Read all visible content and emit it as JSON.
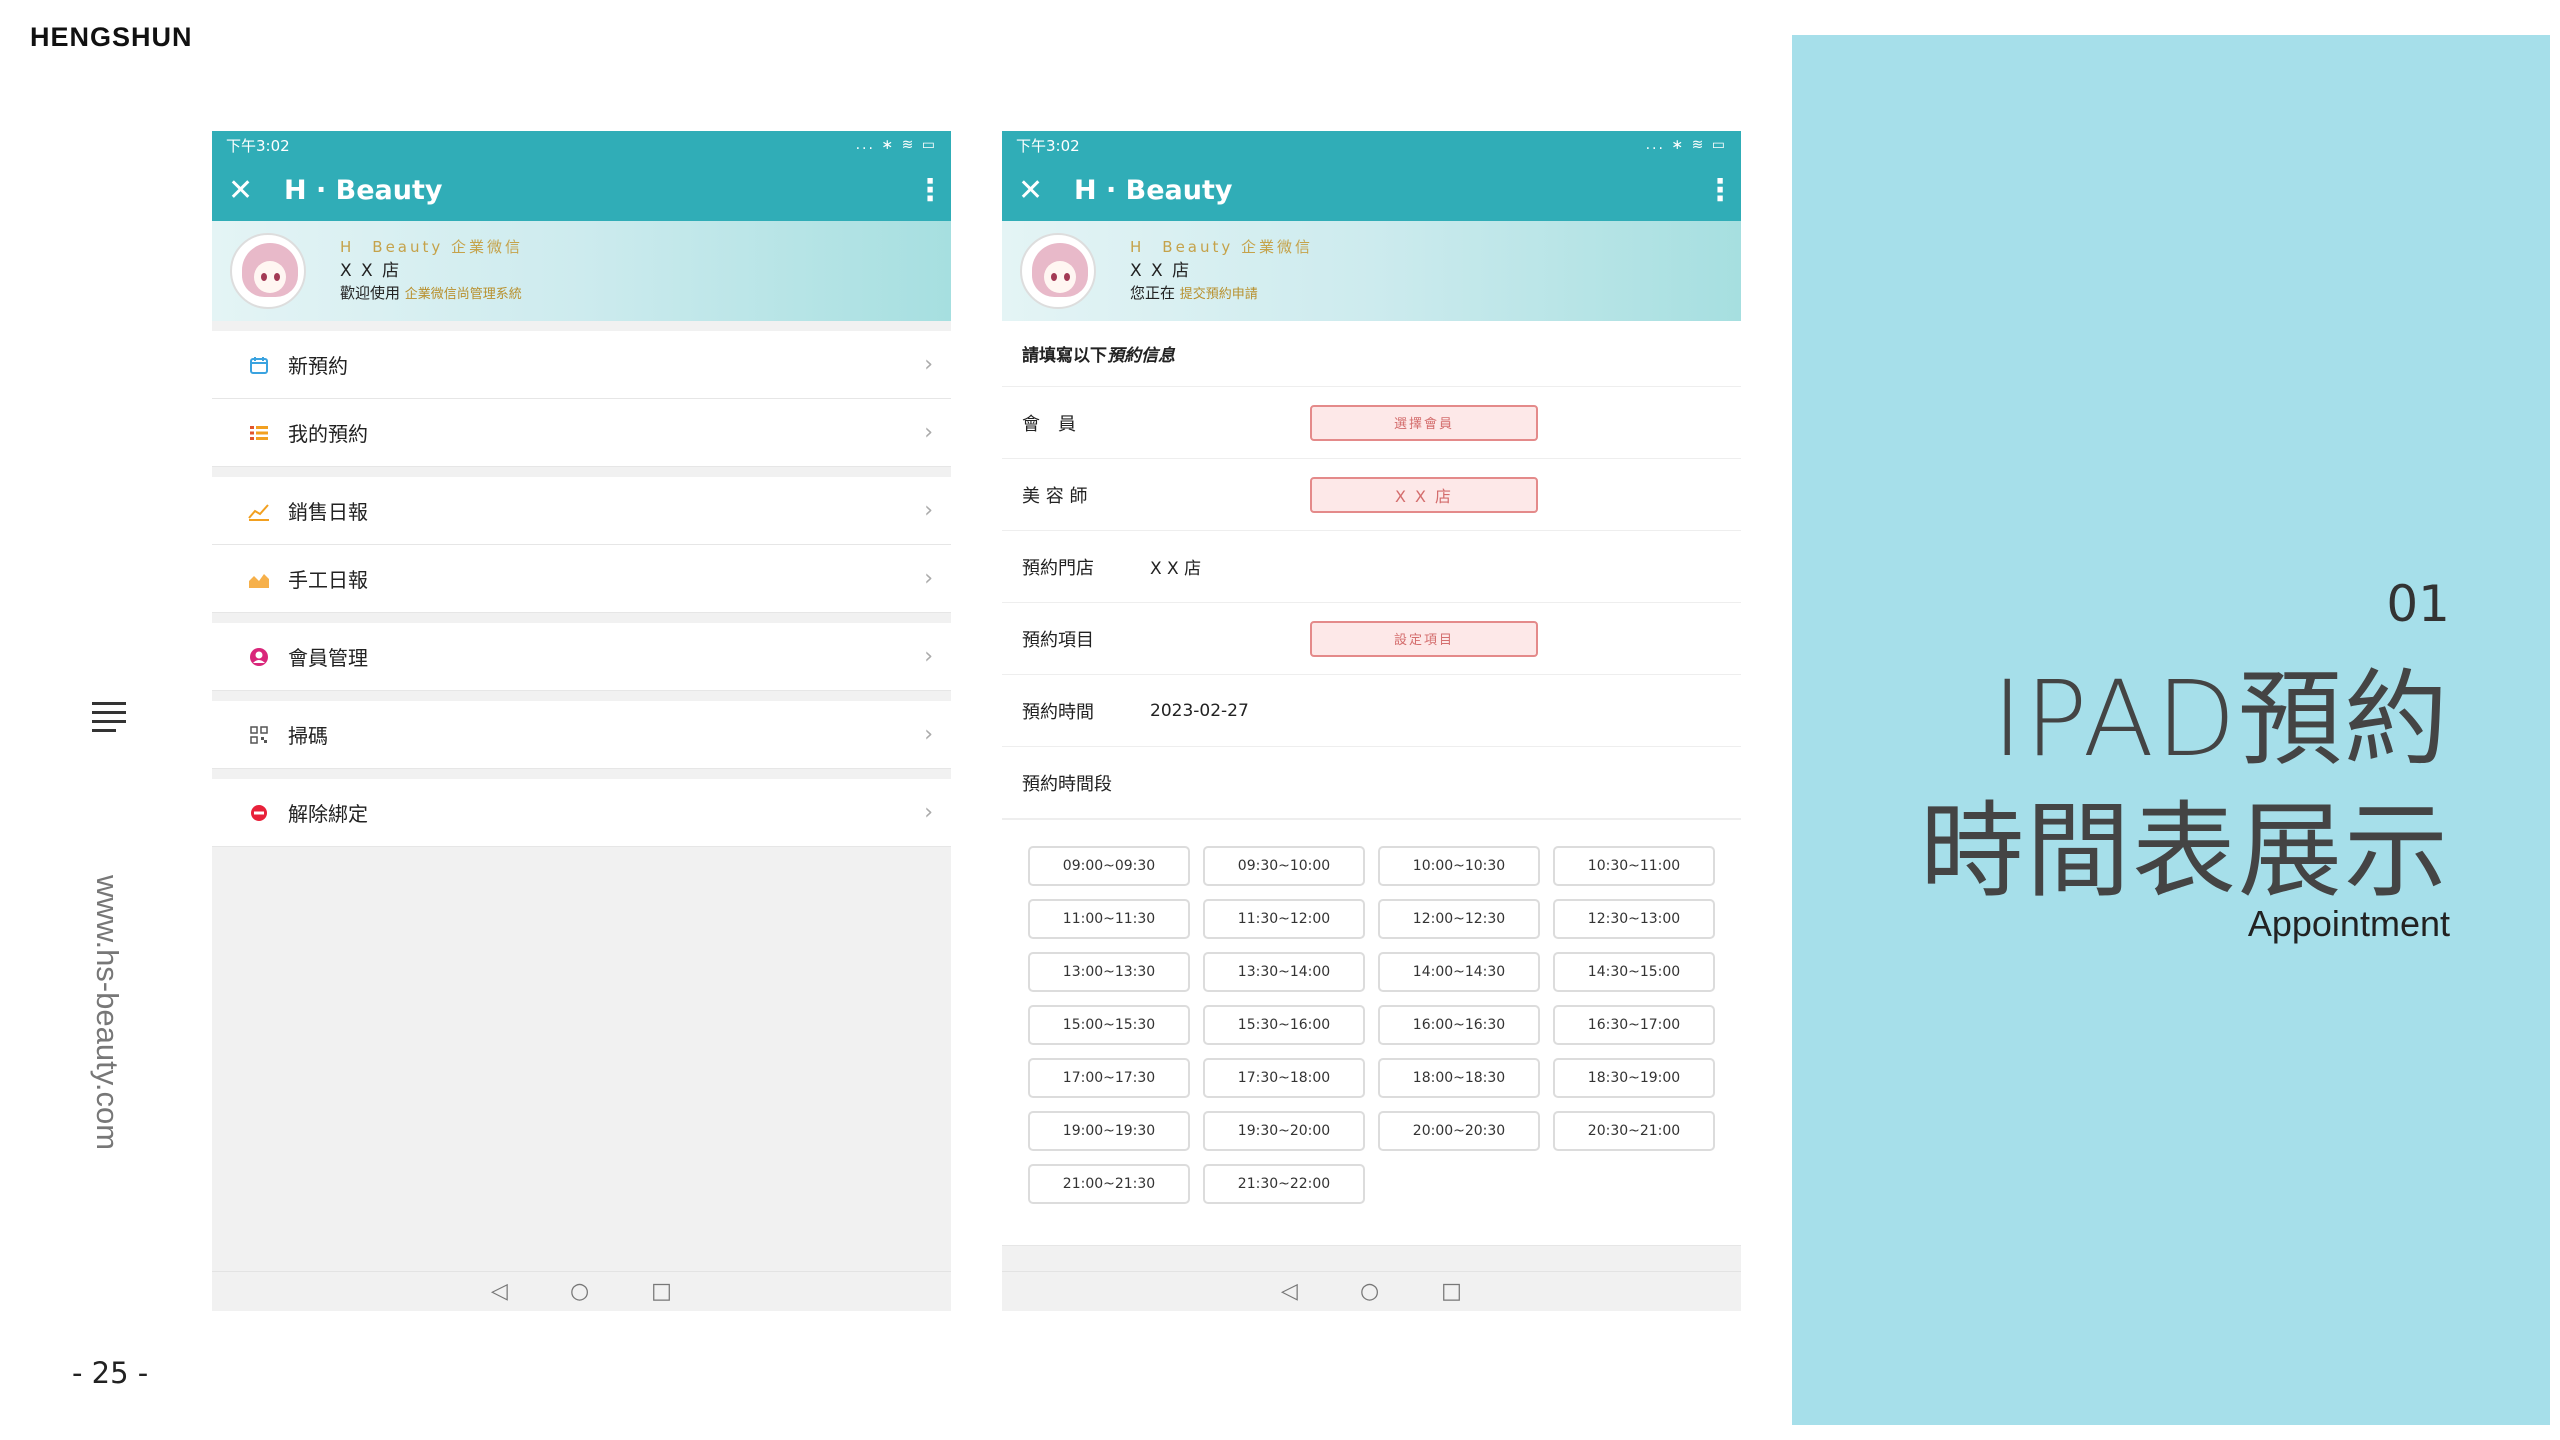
{
  "brand": "HENGSHUN",
  "website": "www.hs-beauty.com",
  "page_number": "- 25 -",
  "phone": {
    "time": "下午3:02",
    "status_icons": "... ∗ ≋ ▭",
    "app_title": "H · Beauty",
    "company": "H　Beauty 企業微信",
    "store": "X X 店"
  },
  "left_phone": {
    "welcome": "歡迎使用",
    "welcome_hl": "企業微信尚管理系統",
    "menu": [
      {
        "label": "新預約",
        "icon": "calendar-icon"
      },
      {
        "label": "我的預約",
        "icon": "list-icon"
      },
      {
        "label": "銷售日報",
        "icon": "line-chart-icon"
      },
      {
        "label": "手工日報",
        "icon": "area-chart-icon"
      },
      {
        "label": "會員管理",
        "icon": "member-icon"
      },
      {
        "label": "掃碼",
        "icon": "qr-icon"
      },
      {
        "label": "解除綁定",
        "icon": "unbind-icon"
      }
    ]
  },
  "right_phone": {
    "status_line": "您正在",
    "status_hl": "提交預約申請",
    "form_heading_a": "請填寫以下",
    "form_heading_b": "預約信息",
    "member_label": "會　員",
    "member_btn": "選擇會員",
    "beautician_label": "美 容 師",
    "beautician_btn": "X X 店",
    "store_label": "預約門店",
    "store_value": "X X 店",
    "item_label": "預約項目",
    "item_btn": "設定項目",
    "time_label": "預約時間",
    "time_value": "2023-02-27",
    "slot_label": "預約時間段",
    "slots": [
      "09:00~09:30",
      "09:30~10:00",
      "10:00~10:30",
      "10:30~11:00",
      "11:00~11:30",
      "11:30~12:00",
      "12:00~12:30",
      "12:30~13:00",
      "13:00~13:30",
      "13:30~14:00",
      "14:00~14:30",
      "14:30~15:00",
      "15:00~15:30",
      "15:30~16:00",
      "16:00~16:30",
      "16:30~17:00",
      "17:00~17:30",
      "17:30~18:00",
      "18:00~18:30",
      "18:30~19:00",
      "19:00~19:30",
      "19:30~20:00",
      "20:00~20:30",
      "20:30~21:00",
      "21:00~21:30",
      "21:30~22:00"
    ]
  },
  "nav": {
    "back": "◁",
    "home": "○",
    "recent": "□"
  },
  "panel": {
    "number": "01",
    "title_line1": "IPAD預約",
    "title_line2": "時間表展示",
    "subtitle": "Appointment",
    "bg": "#a6dfea"
  },
  "colors": {
    "accent": "#30adb7",
    "pill_border": "#e48a8a"
  }
}
